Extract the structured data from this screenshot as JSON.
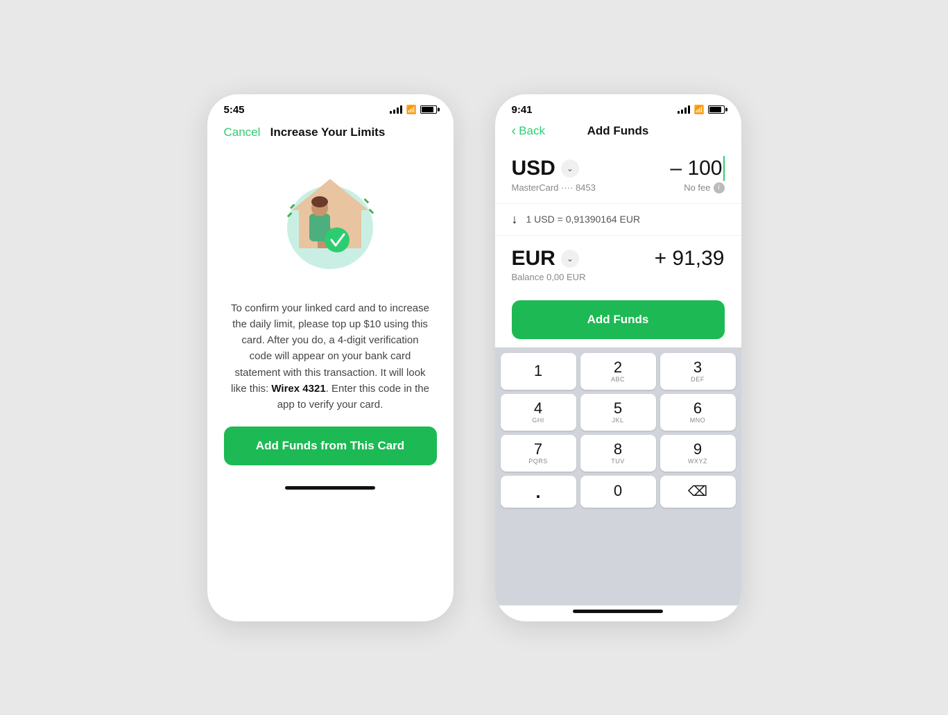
{
  "left_phone": {
    "status_time": "5:45",
    "nav": {
      "cancel_label": "Cancel",
      "title": "Increase Your Limits"
    },
    "description": "To confirm your linked card and to increase the daily limit, please top up $10 using this card. After you do, a 4-digit verification code will appear on your bank card statement with this transaction. It will look like this: ",
    "brand_code": "Wirex 4321",
    "description_end": ". Enter this code in the app to verify your card.",
    "cta_label": "Add Funds from This Card"
  },
  "right_phone": {
    "status_time": "9:41",
    "nav": {
      "back_label": "Back",
      "title": "Add Funds"
    },
    "from": {
      "currency": "USD",
      "amount": "– 100",
      "card_info": "MasterCard ···· 8453",
      "fee_label": "No fee"
    },
    "rate": {
      "label": "1 USD = 0,91390164 EUR"
    },
    "to": {
      "currency": "EUR",
      "amount": "+ 91,39",
      "balance": "Balance 0,00 EUR"
    },
    "cta_label": "Add Funds",
    "keypad": {
      "rows": [
        [
          {
            "num": "1",
            "letters": ""
          },
          {
            "num": "2",
            "letters": "ABC"
          },
          {
            "num": "3",
            "letters": "DEF"
          }
        ],
        [
          {
            "num": "4",
            "letters": "GHI"
          },
          {
            "num": "5",
            "letters": "JKL"
          },
          {
            "num": "6",
            "letters": "MNO"
          }
        ],
        [
          {
            "num": "7",
            "letters": "PQRS"
          },
          {
            "num": "8",
            "letters": "TUV"
          },
          {
            "num": "9",
            "letters": "WXYZ"
          }
        ],
        [
          {
            "num": ".",
            "letters": "",
            "type": "dot"
          },
          {
            "num": "0",
            "letters": ""
          },
          {
            "num": "⌫",
            "letters": "",
            "type": "delete"
          }
        ]
      ]
    }
  }
}
